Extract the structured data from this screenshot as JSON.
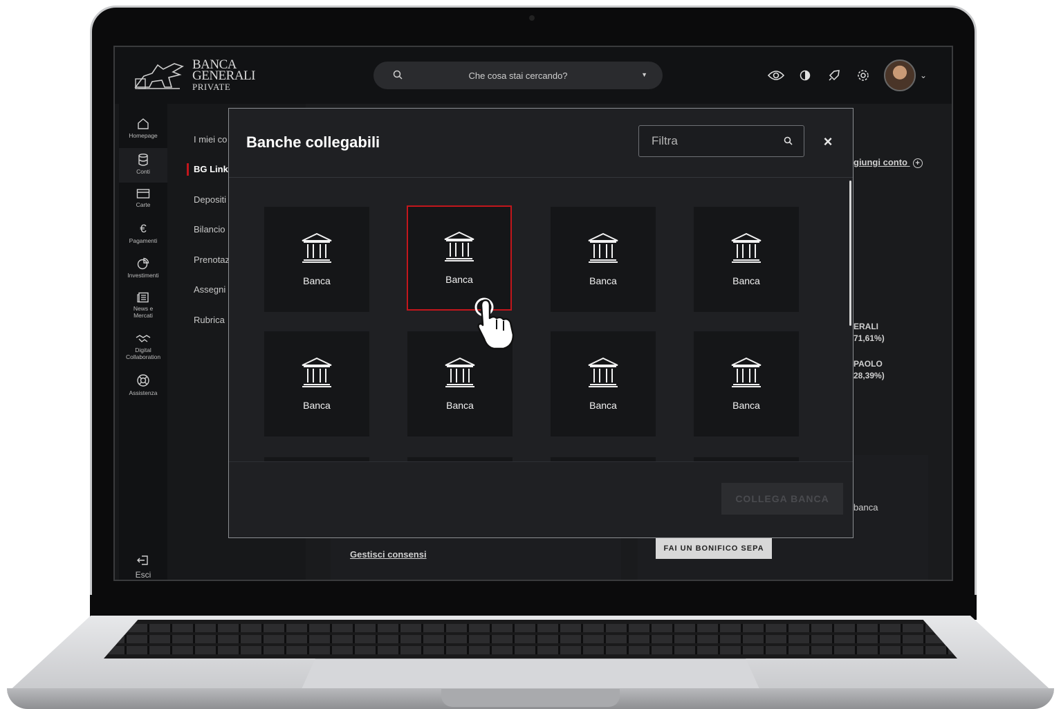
{
  "header": {
    "logo_line1": "BANCA",
    "logo_line2": "GENERALI",
    "logo_line3": "PRIVATE",
    "search_placeholder": "Che cosa stai cercando?",
    "icons": [
      "eye-icon",
      "contrast-icon",
      "rocket-icon",
      "gear-icon"
    ]
  },
  "rail": {
    "items": [
      {
        "label": "Homepage",
        "icon": "home-icon"
      },
      {
        "label": "Conti",
        "icon": "database-icon"
      },
      {
        "label": "Carte",
        "icon": "card-icon"
      },
      {
        "label": "Pagamenti",
        "icon": "euro-icon"
      },
      {
        "label": "Investimenti",
        "icon": "pie-chart-icon"
      },
      {
        "label": "News e Mercati",
        "icon": "news-icon"
      },
      {
        "label": "Digital Collaboration",
        "icon": "handshake-icon"
      },
      {
        "label": "Assistenza",
        "icon": "lifebuoy-icon"
      }
    ],
    "logout_label": "Esci"
  },
  "submenu": {
    "items": [
      "I miei co",
      "BG Link",
      "Depositi",
      "Bilancio",
      "Prenotaz",
      "Assegni",
      "Rubrica"
    ],
    "active": "BG Link"
  },
  "background": {
    "add_account": "giungi conto",
    "legend_1_line1": "ERALI",
    "legend_1_line2": "71,61%)",
    "legend_2_line1": "PAOLO",
    "legend_2_line2": "28,39%)",
    "side_text": "banca",
    "manage_consents": "Gestisci consensi",
    "sepa_button": "FAI UN BONIFICO SEPA"
  },
  "modal": {
    "title": "Banche collegabili",
    "filter_placeholder": "Filtra",
    "close_symbol": "×",
    "banks": [
      "Banca",
      "Banca",
      "Banca",
      "Banca",
      "Banca",
      "Banca",
      "Banca",
      "Banca"
    ],
    "selected_index": 1,
    "connect_button": "COLLEGA BANCA",
    "accent_color": "#c3161c"
  }
}
